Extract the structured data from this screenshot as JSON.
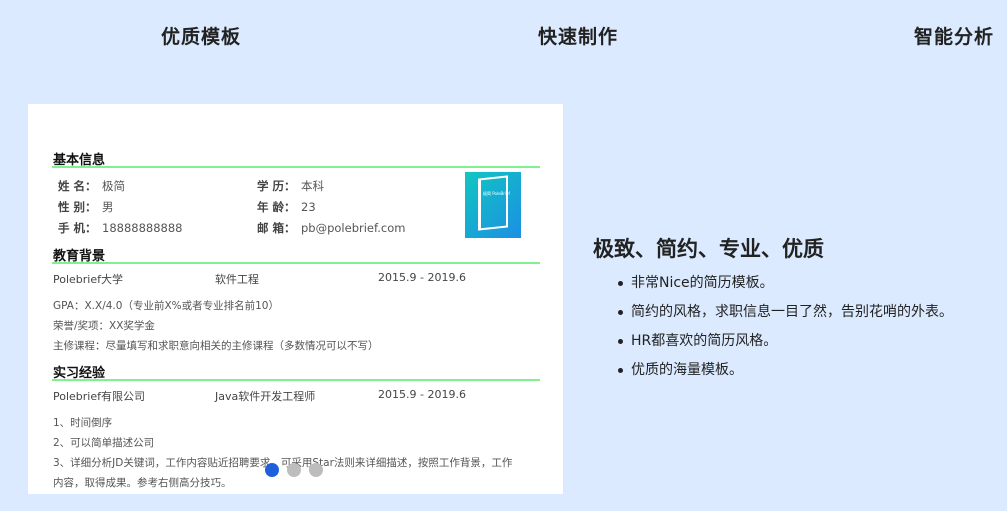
{
  "tabs": [
    "优质模板",
    "快速制作",
    "智能分析"
  ],
  "resume": {
    "basic_title": "基本信息",
    "fields": [
      {
        "label": "姓 名：",
        "value": "极简"
      },
      {
        "label": "性 别：",
        "value": "男"
      },
      {
        "label": "手 机：",
        "value": "18888888888"
      },
      {
        "label": "学 历：",
        "value": "本科"
      },
      {
        "label": "年 龄：",
        "value": "23"
      },
      {
        "label": "邮 箱：",
        "value": "pb@polebrief.com"
      }
    ],
    "photo_text": "极简 PoleBrief",
    "edu_title": "教育背景",
    "edu_row": {
      "school": "Polebrief大学",
      "major": "软件工程",
      "period": "2015.9 - 2019.6"
    },
    "edu_lines": [
      "GPA：X.X/4.0（专业前X%或者专业排名前10）",
      "荣誉/奖项：XX奖学金",
      "主修课程：尽量填写和求职意向相关的主修课程（多数情况可以不写）"
    ],
    "intern_title": "实习经验",
    "intern_row": {
      "company": "Polebrief有限公司",
      "role": "Java软件开发工程师",
      "period": "2015.9 - 2019.6"
    },
    "intern_lines": [
      "1、时间倒序",
      "2、可以简单描述公司",
      "3、详细分析JD关键词，工作内容贴近招聘要求，可采用Star法则来详细描述，按照工作背景，工作",
      "内容，取得成果。参考右侧高分技巧。"
    ]
  },
  "carousel": {
    "count": 3,
    "active": 0
  },
  "feature": {
    "heading": "极致、简约、专业、优质",
    "items": [
      "非常Nice的简历模板。",
      "简约的风格，求职信息一目了然，告别花哨的外表。",
      "HR都喜欢的简历风格。",
      "优质的海量模板。"
    ]
  },
  "colors": {
    "background": "#dbeafe",
    "accent_line": "#7df28e",
    "active_dot": "#1f5fdc"
  }
}
